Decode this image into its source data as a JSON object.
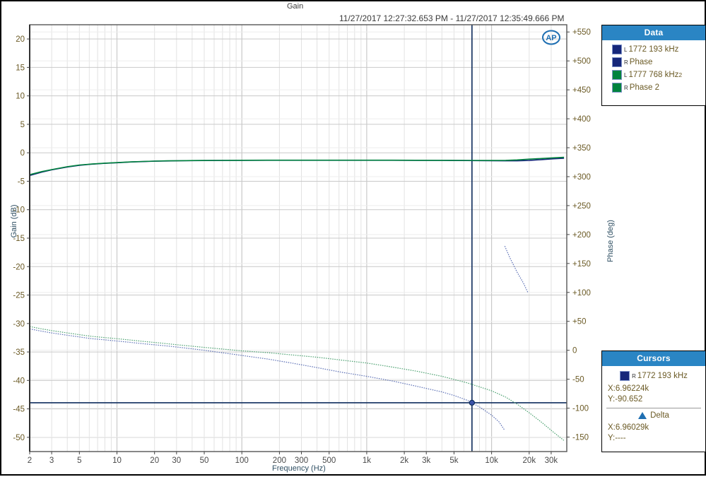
{
  "chart_title": "Gain",
  "chart_subtitle": "11/27/2017 12:27:32.653 PM - 11/27/2017 12:35:49.666 PM",
  "logo": "ap-logo",
  "axes": {
    "x_title": "Frequency (Hz)",
    "y_left_title": "Gain (dB)",
    "y_right_title": "Phase (deg)"
  },
  "legend": {
    "header": "Data",
    "items": [
      {
        "channel": "L",
        "label": "1772 193 kHz",
        "color": "#16277a",
        "sub": ""
      },
      {
        "channel": "R",
        "label": "Phase",
        "color": "#16277a",
        "sub": ""
      },
      {
        "channel": "L",
        "label": "1777 768 kHz",
        "color": "#00833e",
        "sub": "2"
      },
      {
        "channel": "R",
        "label": "Phase 2",
        "color": "#00833e",
        "sub": ""
      }
    ]
  },
  "cursors": {
    "header": "Cursors",
    "trace_channel": "R",
    "trace_label": "1772 193 kHz",
    "trace_color": "#16277a",
    "x_value": "X:6.96224k",
    "y_value": "Y:-90.652",
    "delta_label": "Delta",
    "delta_x": "X:6.96029k",
    "delta_y": "Y:----"
  },
  "chart_data": {
    "type": "line",
    "title": "Gain",
    "subtitle": "11/27/2017 12:27:32.653 PM - 11/27/2017 12:35:49.666 PM",
    "xlabel": "Frequency (Hz)",
    "ylabel": "Gain (dB)",
    "y2label": "Phase (deg)",
    "xscale": "log",
    "xlim": [
      2,
      40000
    ],
    "ylim": [
      -52.5,
      22.5
    ],
    "y2lim": [
      -175,
      562.5
    ],
    "grid": true,
    "legend_position": "outside-right-top",
    "xticks": [
      2,
      3,
      5,
      10,
      20,
      30,
      50,
      100,
      200,
      300,
      500,
      1000,
      2000,
      3000,
      5000,
      10000,
      20000,
      30000
    ],
    "xticklabels": [
      "2",
      "3",
      "5",
      "10",
      "20",
      "30",
      "50",
      "100",
      "200",
      "300",
      "500",
      "1k",
      "2k",
      "3k",
      "5k",
      "10k",
      "20k",
      "30k"
    ],
    "yticks": [
      20,
      15,
      10,
      5,
      0,
      -5,
      -10,
      -15,
      -20,
      -25,
      -30,
      -35,
      -40,
      -45,
      -50
    ],
    "yticklabels": [
      "20",
      "15",
      "10",
      "5",
      "0",
      "-5",
      "-10",
      "-15",
      "-20",
      "-25",
      "-30",
      "-35",
      "-40",
      "-45",
      "-50"
    ],
    "y2ticks": [
      550,
      500,
      450,
      400,
      350,
      300,
      250,
      200,
      150,
      100,
      50,
      0,
      -50,
      -100,
      -150
    ],
    "y2ticklabels": [
      "+550",
      "+500",
      "+450",
      "+400",
      "+350",
      "+300",
      "+250",
      "+200",
      "+150",
      "+100",
      "+50",
      "0",
      "-50",
      "-100",
      "-150"
    ],
    "cursor_vertical_x": 6962.24,
    "cursor_horizontal_y2": -90.652,
    "series": [
      {
        "name": "1772 193 kHz",
        "axis": "left",
        "color": "#16277a",
        "style": "solid",
        "x": [
          2,
          2.5,
          3,
          4,
          5,
          6.3,
          8,
          10,
          13,
          16,
          20,
          25,
          32,
          40,
          50,
          63,
          80,
          100,
          160,
          250,
          400,
          630,
          1000,
          1600,
          2500,
          4000,
          6300,
          10000,
          13000,
          16000,
          20000,
          25000,
          31500,
          38000
        ],
        "y": [
          -4.0,
          -3.4,
          -3.0,
          -2.5,
          -2.2,
          -2.0,
          -1.85,
          -1.75,
          -1.62,
          -1.55,
          -1.48,
          -1.44,
          -1.4,
          -1.38,
          -1.36,
          -1.35,
          -1.34,
          -1.33,
          -1.32,
          -1.32,
          -1.32,
          -1.32,
          -1.32,
          -1.32,
          -1.33,
          -1.34,
          -1.36,
          -1.4,
          -1.42,
          -1.42,
          -1.35,
          -1.2,
          -1.05,
          -0.95
        ]
      },
      {
        "name": "1777 768 kHz 2",
        "axis": "left",
        "color": "#00833e",
        "style": "solid",
        "x": [
          2,
          2.5,
          3,
          4,
          5,
          6.3,
          8,
          10,
          13,
          16,
          20,
          25,
          32,
          40,
          50,
          63,
          80,
          100,
          160,
          250,
          400,
          630,
          1000,
          1600,
          2500,
          4000,
          6300,
          10000,
          13000,
          16000,
          20000,
          25000,
          31500,
          38000
        ],
        "y": [
          -3.85,
          -3.3,
          -2.95,
          -2.45,
          -2.15,
          -1.97,
          -1.83,
          -1.73,
          -1.6,
          -1.53,
          -1.46,
          -1.42,
          -1.39,
          -1.37,
          -1.35,
          -1.34,
          -1.33,
          -1.32,
          -1.31,
          -1.31,
          -1.31,
          -1.31,
          -1.31,
          -1.31,
          -1.32,
          -1.33,
          -1.34,
          -1.35,
          -1.33,
          -1.25,
          -1.12,
          -1.0,
          -0.88,
          -0.8
        ]
      },
      {
        "name": "Phase",
        "axis": "right",
        "color": "#5b6fb5",
        "style": "dotted",
        "x": [
          2,
          2.5,
          3,
          4,
          5,
          6.3,
          8,
          10,
          13,
          16,
          20,
          25,
          32,
          40,
          50,
          63,
          80,
          100,
          160,
          250,
          400,
          630,
          1000,
          1600,
          2500,
          4000,
          5000,
          6300,
          6962,
          8000,
          10000,
          11500,
          12700,
          12750,
          14000,
          16000,
          18000,
          19500
        ],
        "y": [
          37,
          33,
          30,
          26,
          23,
          20,
          18,
          16,
          13.5,
          11.5,
          9.5,
          7.5,
          5,
          2.5,
          0,
          -3,
          -6,
          -9,
          -15,
          -22,
          -30,
          -38,
          -45,
          -53,
          -62,
          -72,
          -78,
          -86,
          -90.65,
          -98,
          -112,
          -124,
          -138,
          180,
          160,
          135,
          116,
          100
        ]
      },
      {
        "name": "Phase 2",
        "axis": "right",
        "color": "#4aa06f",
        "style": "dotted",
        "x": [
          2,
          2.5,
          3,
          4,
          5,
          6.3,
          8,
          10,
          13,
          16,
          20,
          25,
          32,
          40,
          50,
          63,
          80,
          100,
          160,
          250,
          400,
          630,
          1000,
          1600,
          2500,
          4000,
          6300,
          10000,
          13000,
          16000,
          20000,
          25000,
          31500,
          38000
        ],
        "y": [
          41,
          37,
          34,
          30,
          27,
          24,
          22,
          20,
          17.5,
          15.5,
          13.5,
          11.5,
          9,
          7,
          5,
          3,
          1,
          -1,
          -4,
          -8,
          -12,
          -17,
          -22,
          -29,
          -36,
          -45,
          -56,
          -70,
          -81,
          -93,
          -108,
          -124,
          -142,
          -156
        ]
      }
    ]
  }
}
